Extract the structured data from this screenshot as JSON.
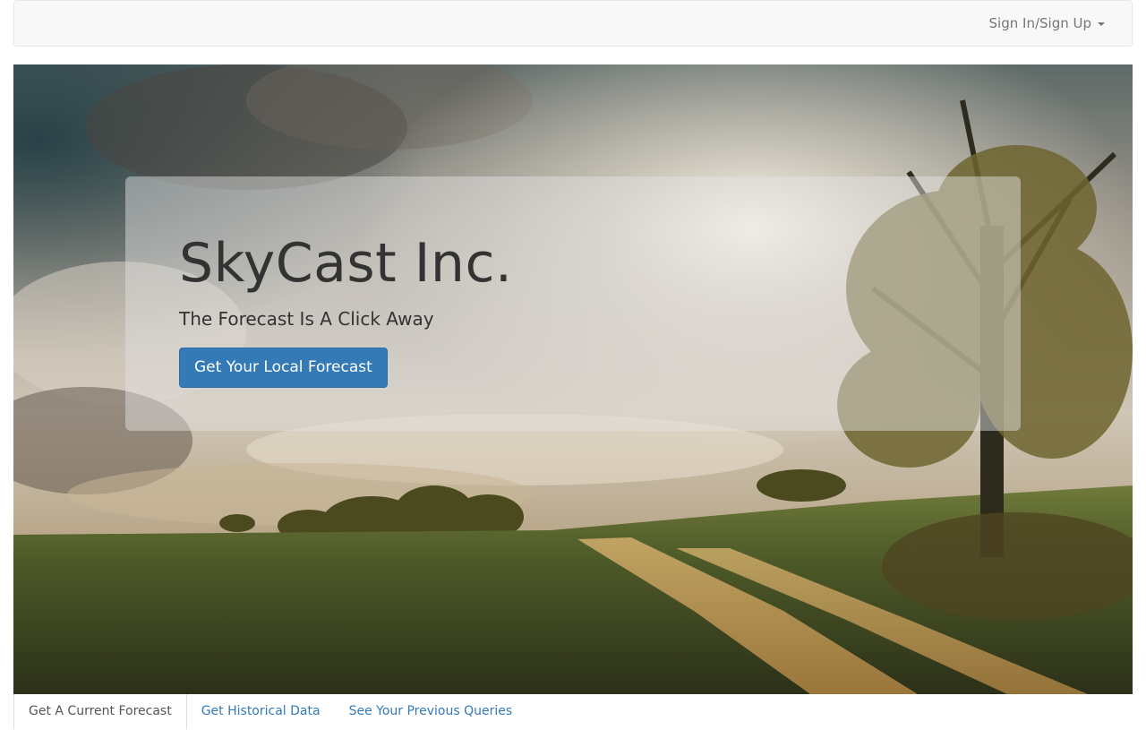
{
  "navbar": {
    "dropdown_label": "Sign In/Sign Up",
    "dropdown_icon": "caret-down-icon"
  },
  "hero": {
    "background_image": "countryside-landscape-photo",
    "title": "SkyCast Inc.",
    "subtitle": "The Forecast Is A Click Away",
    "cta_label": "Get Your Local Forecast"
  },
  "tabs": [
    {
      "label": "Get A Current Forecast",
      "active": true
    },
    {
      "label": "Get Historical Data",
      "active": false
    },
    {
      "label": "See Your Previous Queries",
      "active": false
    }
  ],
  "colors": {
    "primary": "#337ab7",
    "navbar_bg": "#f8f8f8",
    "nav_text": "#777777",
    "title_text": "#333333"
  }
}
